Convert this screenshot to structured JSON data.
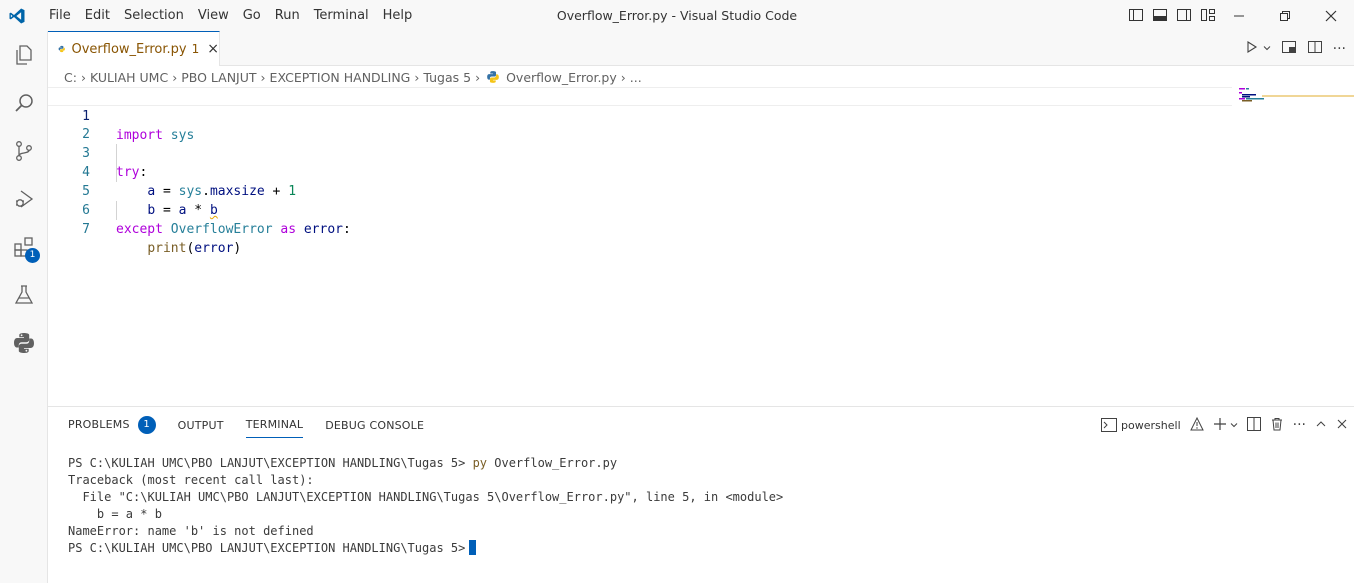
{
  "window": {
    "title": "Overflow_Error.py - Visual Studio Code",
    "menu": [
      "File",
      "Edit",
      "Selection",
      "View",
      "Go",
      "Run",
      "Terminal",
      "Help"
    ]
  },
  "activity_bar": {
    "items": [
      "explorer-icon",
      "search-icon",
      "source-control-icon",
      "run-debug-icon",
      "extensions-icon",
      "testing-icon",
      "python-icon"
    ],
    "extensions_badge": "1"
  },
  "tab": {
    "label": "Overflow_Error.py",
    "problem_count": "1",
    "close": "×"
  },
  "breadcrumb": [
    "C:",
    "KULIAH UMC",
    "PBO LANJUT",
    "EXCEPTION HANDLING",
    "Tugas 5",
    "Overflow_Error.py",
    "..."
  ],
  "editor": {
    "line_numbers": [
      "1",
      "2",
      "3",
      "4",
      "5",
      "6",
      "7"
    ],
    "tokens": {
      "l1_import": "import",
      "l1_sys": "sys",
      "l3_try": "try",
      "l3_colon": ":",
      "l4_a": "a",
      "l4_eq": " = ",
      "l4_sys": "sys",
      "l4_dot": ".",
      "l4_maxsize": "maxsize",
      "l4_plus": " + ",
      "l4_one": "1",
      "l5_b": "b",
      "l5_eq": " = ",
      "l5_a": "a",
      "l5_star": " * ",
      "l5_b2": "b",
      "l6_except": "except",
      "l6_overflow": "OverflowError",
      "l6_as": "as",
      "l6_error": "error",
      "l6_colon": ":",
      "l7_print": "print",
      "l7_open": "(",
      "l7_error": "error",
      "l7_close": ")"
    }
  },
  "panel": {
    "tabs": [
      "PROBLEMS",
      "OUTPUT",
      "TERMINAL",
      "DEBUG CONSOLE"
    ],
    "problems_count": "1",
    "active_tab": "TERMINAL",
    "shell": "powershell"
  },
  "terminal": {
    "prompt1": "PS C:\\KULIAH UMC\\PBO LANJUT\\EXCEPTION HANDLING\\Tugas 5> ",
    "cmd_py": "py",
    "cmd_rest": " Overflow_Error.py",
    "line2": "Traceback (most recent call last):",
    "line3": "  File \"C:\\KULIAH UMC\\PBO LANJUT\\EXCEPTION HANDLING\\Tugas 5\\Overflow_Error.py\", line 5, in <module>",
    "line4": "    b = a * b",
    "line5": "NameError: name 'b' is not defined",
    "prompt2": "PS C:\\KULIAH UMC\\PBO LANJUT\\EXCEPTION HANDLING\\Tugas 5>"
  },
  "colors": {
    "accent": "#005fb8",
    "tab_modified": "#895503",
    "keyword": "#af00db",
    "type": "#267f99"
  }
}
